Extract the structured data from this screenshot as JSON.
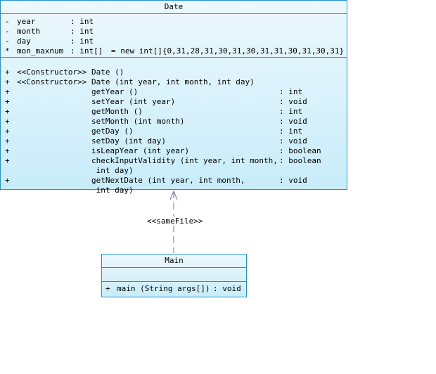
{
  "diagram": {
    "date_class": {
      "name": "Date",
      "attributes": [
        {
          "visibility": "-",
          "name": "year",
          "type": ": int",
          "default": ""
        },
        {
          "visibility": "-",
          "name": "month",
          "type": ": int",
          "default": ""
        },
        {
          "visibility": "-",
          "name": "day",
          "type": ": int",
          "default": ""
        },
        {
          "visibility": "*",
          "name": "mon_maxnum",
          "type": ": int[]",
          "default": "= new int[]{0,31,28,31,30,31,30,31,31,30,31,30,31}"
        }
      ],
      "operations": [
        {
          "visibility": "+",
          "stereotype": "<<Constructor>>",
          "signature": "Date ()",
          "returns": ""
        },
        {
          "visibility": "+",
          "stereotype": "<<Constructor>>",
          "signature": "Date (int year, int month, int day)",
          "returns": ""
        },
        {
          "visibility": "+",
          "stereotype": "",
          "signature": "getYear ()",
          "returns": ": int"
        },
        {
          "visibility": "+",
          "stereotype": "",
          "signature": "setYear (int year)",
          "returns": ": void"
        },
        {
          "visibility": "+",
          "stereotype": "",
          "signature": "getMonth ()",
          "returns": ": int"
        },
        {
          "visibility": "+",
          "stereotype": "",
          "signature": "setMonth (int month)",
          "returns": ": void"
        },
        {
          "visibility": "+",
          "stereotype": "",
          "signature": "getDay ()",
          "returns": ": int"
        },
        {
          "visibility": "+",
          "stereotype": "",
          "signature": "setDay (int day)",
          "returns": ": void"
        },
        {
          "visibility": "+",
          "stereotype": "",
          "signature": "isLeapYear (int year)",
          "returns": ": boolean"
        },
        {
          "visibility": "+",
          "stereotype": "",
          "signature": "checkInputValidity (int year, int month,",
          "continuation": " int day)",
          "returns": ": boolean"
        },
        {
          "visibility": "+",
          "stereotype": "",
          "signature": "getNextDate (int year, int month,",
          "continuation": " int day)",
          "returns": ": void"
        }
      ]
    },
    "main_class": {
      "name": "Main",
      "attributes": [],
      "operations": [
        {
          "visibility": "+",
          "signature": "main (String args[])",
          "returns": ": void"
        }
      ]
    },
    "dependency": {
      "stereotype": "<<sameFile>>",
      "from": "Main",
      "to": "Date"
    },
    "colors": {
      "border": "#1e90d6",
      "fill_top": "#ecf8fd",
      "fill_bottom": "#c8ecfa",
      "connector": "#7a6fa8"
    }
  }
}
